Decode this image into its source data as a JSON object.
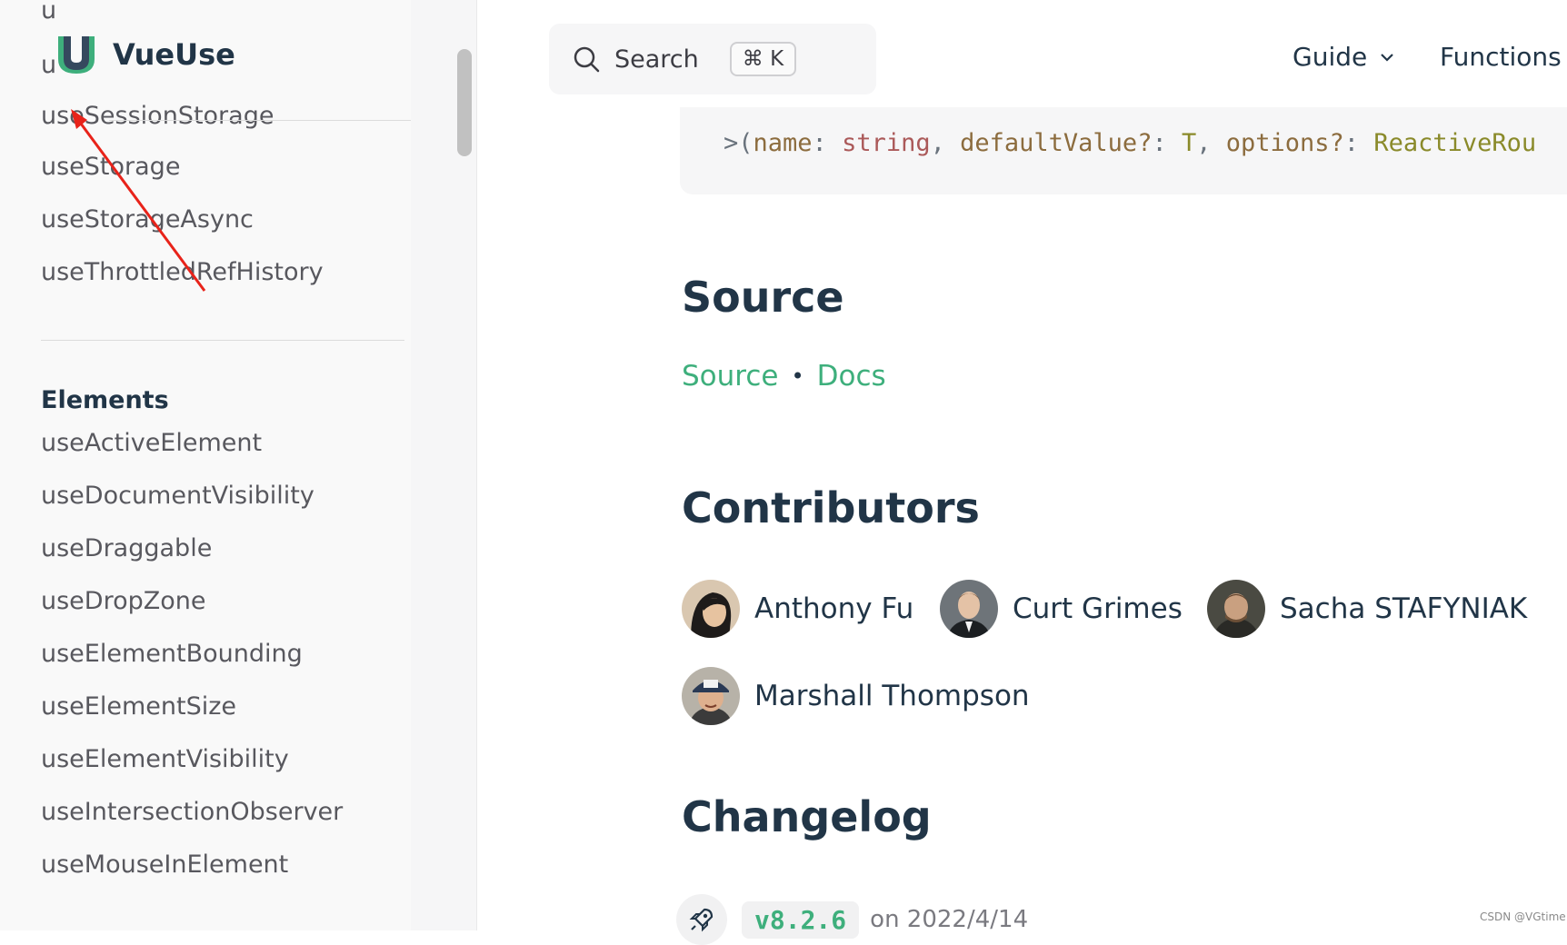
{
  "sidebar": {
    "top_fragment": "u",
    "brand_fragment": "u",
    "brand_name": "VueUse",
    "overlapped_item": "useSessionStorage",
    "items_top": [
      "useStorage",
      "useStorageAsync",
      "useThrottledRefHistory"
    ],
    "elements_heading": "Elements",
    "elements_items": [
      "useActiveElement",
      "useDocumentVisibility",
      "useDraggable",
      "useDropZone",
      "useElementBounding",
      "useElementSize",
      "useElementVisibility",
      "useIntersectionObserver",
      "useMouseInElement"
    ]
  },
  "nav": {
    "search_label": "Search",
    "shortcut": "⌘ K",
    "guide": "Guide",
    "functions": "Functions"
  },
  "code": {
    "prefix": ">(",
    "p1_name": "name",
    "p1_type": "string",
    "p2_name": "defaultValue?",
    "p2_type": "T",
    "p3_name": "options?",
    "p3_type": "ReactiveRou"
  },
  "sections": {
    "source_heading": "Source",
    "source_link": "Source",
    "separator": "•",
    "docs_link": "Docs",
    "contributors_heading": "Contributors",
    "changelog_heading": "Changelog"
  },
  "contributors": [
    "Anthony Fu",
    "Curt Grimes",
    "Sacha STAFYNIAK",
    "Marshall Thompson"
  ],
  "changelog": {
    "version": "v8.2.6",
    "date": "on 2022/4/14"
  },
  "watermark": "CSDN @VGtime",
  "colors": {
    "accent": "#3eaf7c",
    "text": "#213547",
    "annotation": "#e8231a"
  }
}
